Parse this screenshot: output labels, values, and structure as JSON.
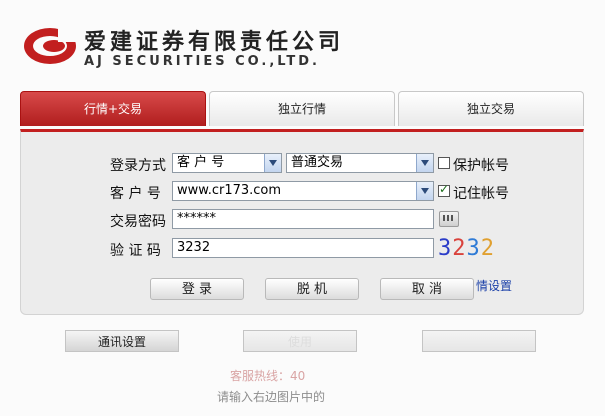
{
  "brand": {
    "name_cn": "爱建证券有限责任公司",
    "name_en": "AJ SECURITIES CO.,LTD."
  },
  "colors": {
    "accent": "#c21f1f",
    "link": "#1a3fa8"
  },
  "tabs": [
    {
      "label": "行情+交易",
      "active": true
    },
    {
      "label": "独立行情",
      "active": false
    },
    {
      "label": "独立交易",
      "active": false
    }
  ],
  "form": {
    "login_mode": {
      "label": "登录方式",
      "type_value": "客 户 号",
      "trade_value": "普通交易"
    },
    "protect_account": {
      "label": "保护帐号",
      "checked": false
    },
    "account": {
      "label": "客 户 号",
      "value": "www.cr173.com"
    },
    "remember_account": {
      "label": "记住帐号",
      "checked": true
    },
    "password": {
      "label": "交易密码",
      "value": "******"
    },
    "captcha": {
      "label": "验 证 码",
      "value": "3232",
      "image_chars": [
        "3",
        "2",
        "3",
        "2"
      ]
    }
  },
  "buttons": {
    "login": "登 录",
    "offline": "脱 机",
    "cancel": "取 消"
  },
  "link_fragment": "情设置",
  "bottom": {
    "comm_settings": "通讯设置",
    "middle_fragment": "使用",
    "hotline_fragment": "客服热线：40",
    "hint_fragment": "请输入右边图片中的"
  }
}
